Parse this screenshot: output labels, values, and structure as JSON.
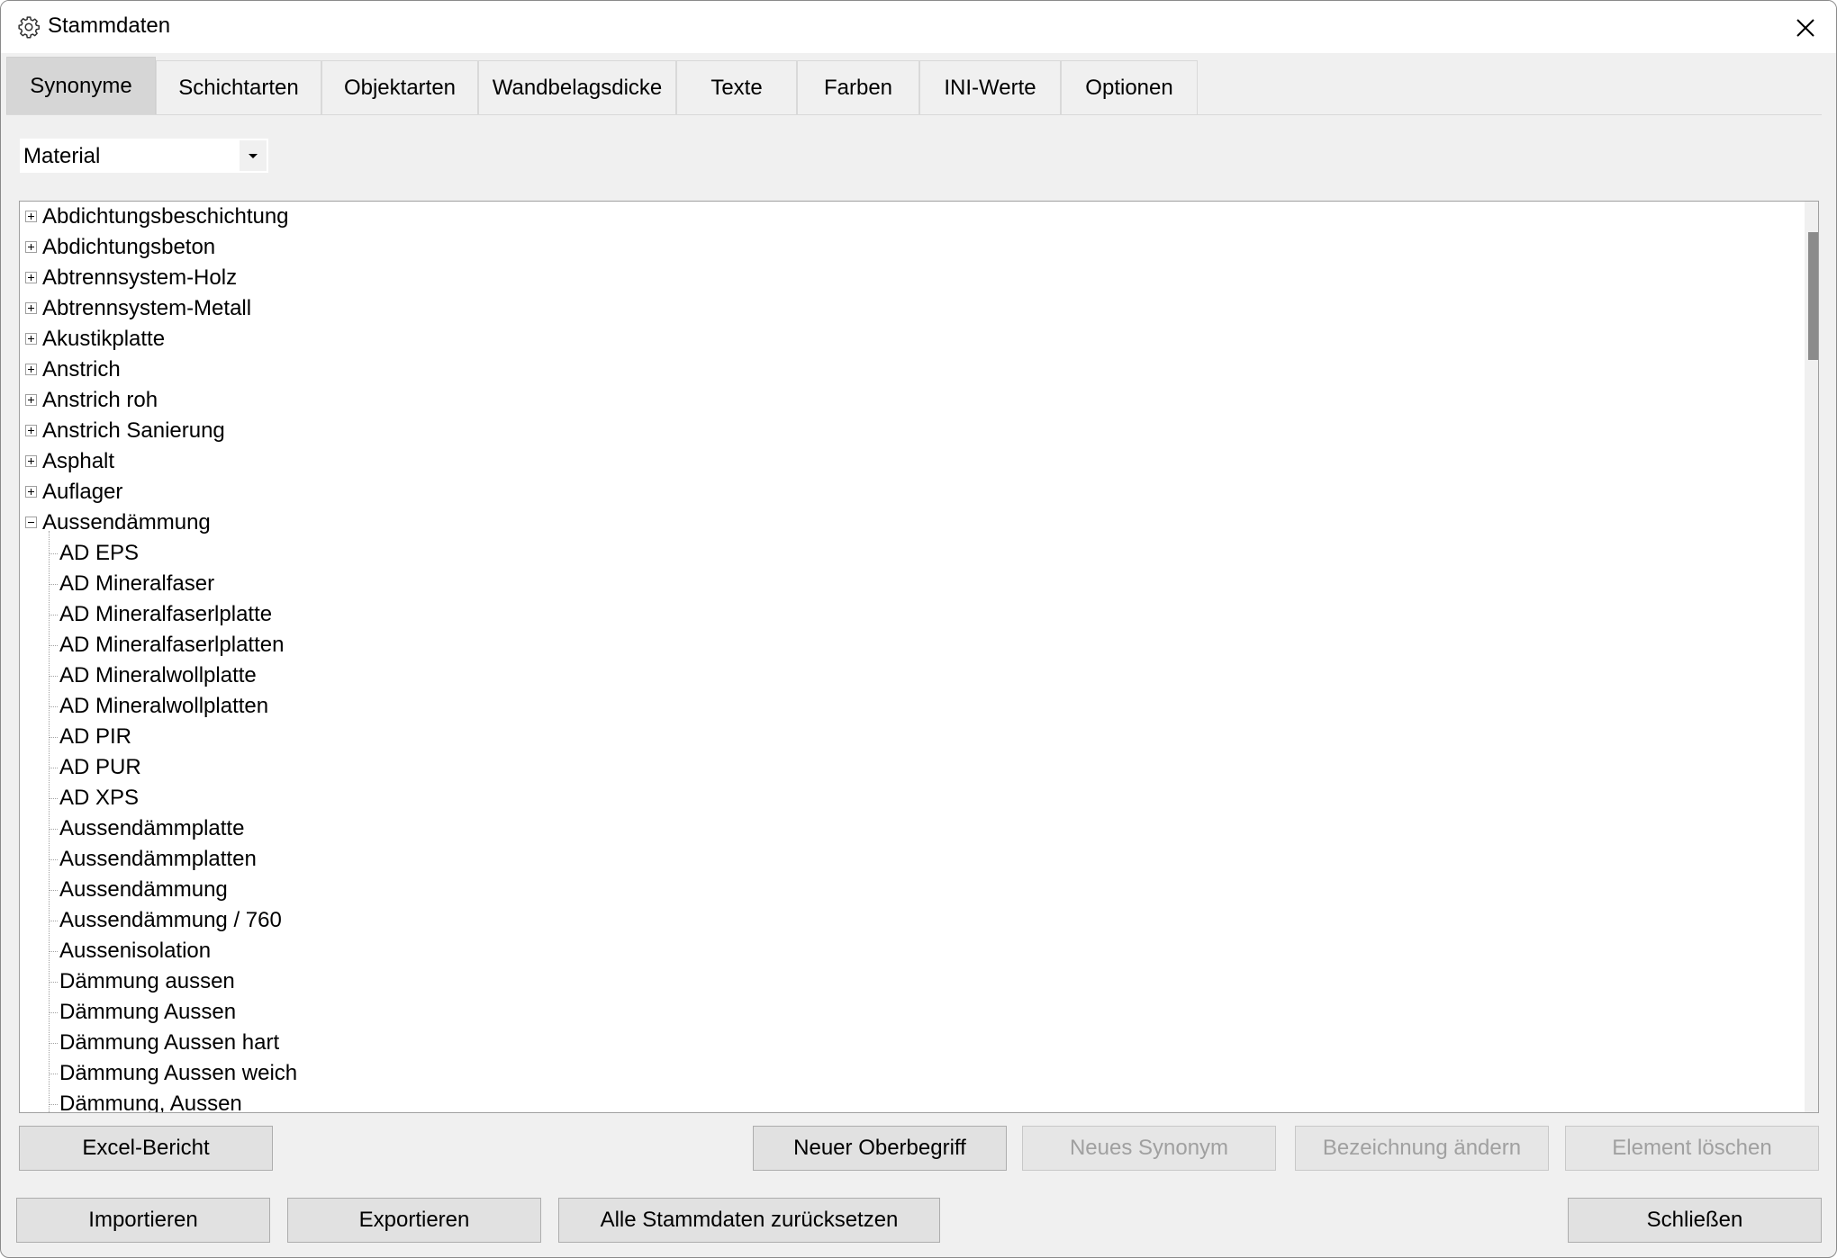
{
  "window": {
    "title": "Stammdaten"
  },
  "tabs": [
    {
      "label": "Synonyme",
      "active": true
    },
    {
      "label": "Schichtarten"
    },
    {
      "label": "Objektarten"
    },
    {
      "label": "Wandbelagsdicke"
    },
    {
      "label": "Texte"
    },
    {
      "label": "Farben"
    },
    {
      "label": "INI-Werte"
    },
    {
      "label": "Optionen"
    }
  ],
  "category_select": {
    "value": "Material"
  },
  "tree": {
    "collapsed_items": [
      "Abdichtungsbeschichtung",
      "Abdichtungsbeton",
      "Abtrennsystem-Holz",
      "Abtrennsystem-Metall",
      "Akustikplatte",
      "Anstrich",
      "Anstrich roh",
      "Anstrich Sanierung",
      "Asphalt",
      "Auflager"
    ],
    "expanded_item": "Aussendämmung",
    "children": [
      "AD EPS",
      "AD Mineralfaser",
      "AD Mineralfaserlplatte",
      "AD Mineralfaserlplatten",
      "AD Mineralwollplatte",
      "AD Mineralwollplatten",
      "AD PIR",
      "AD PUR",
      "AD XPS",
      "Aussendämmplatte",
      "Aussendämmplatten",
      "Aussendämmung",
      "Aussendämmung / 760",
      "Aussenisolation",
      "Dämmung aussen",
      "Dämmung Aussen",
      "Dämmung Aussen hart",
      "Dämmung Aussen weich",
      "Dämmung, Aussen"
    ]
  },
  "buttons": {
    "excel_report": "Excel-Bericht",
    "new_term": "Neuer Oberbegriff",
    "new_synonym": "Neues Synonym",
    "rename": "Bezeichnung ändern",
    "delete": "Element löschen",
    "import": "Importieren",
    "export": "Exportieren",
    "reset_all": "Alle Stammdaten zurücksetzen",
    "close": "Schließen"
  },
  "icons": {
    "app": "gear-icon",
    "close": "close-icon",
    "dropdown": "chevron-down-icon"
  }
}
